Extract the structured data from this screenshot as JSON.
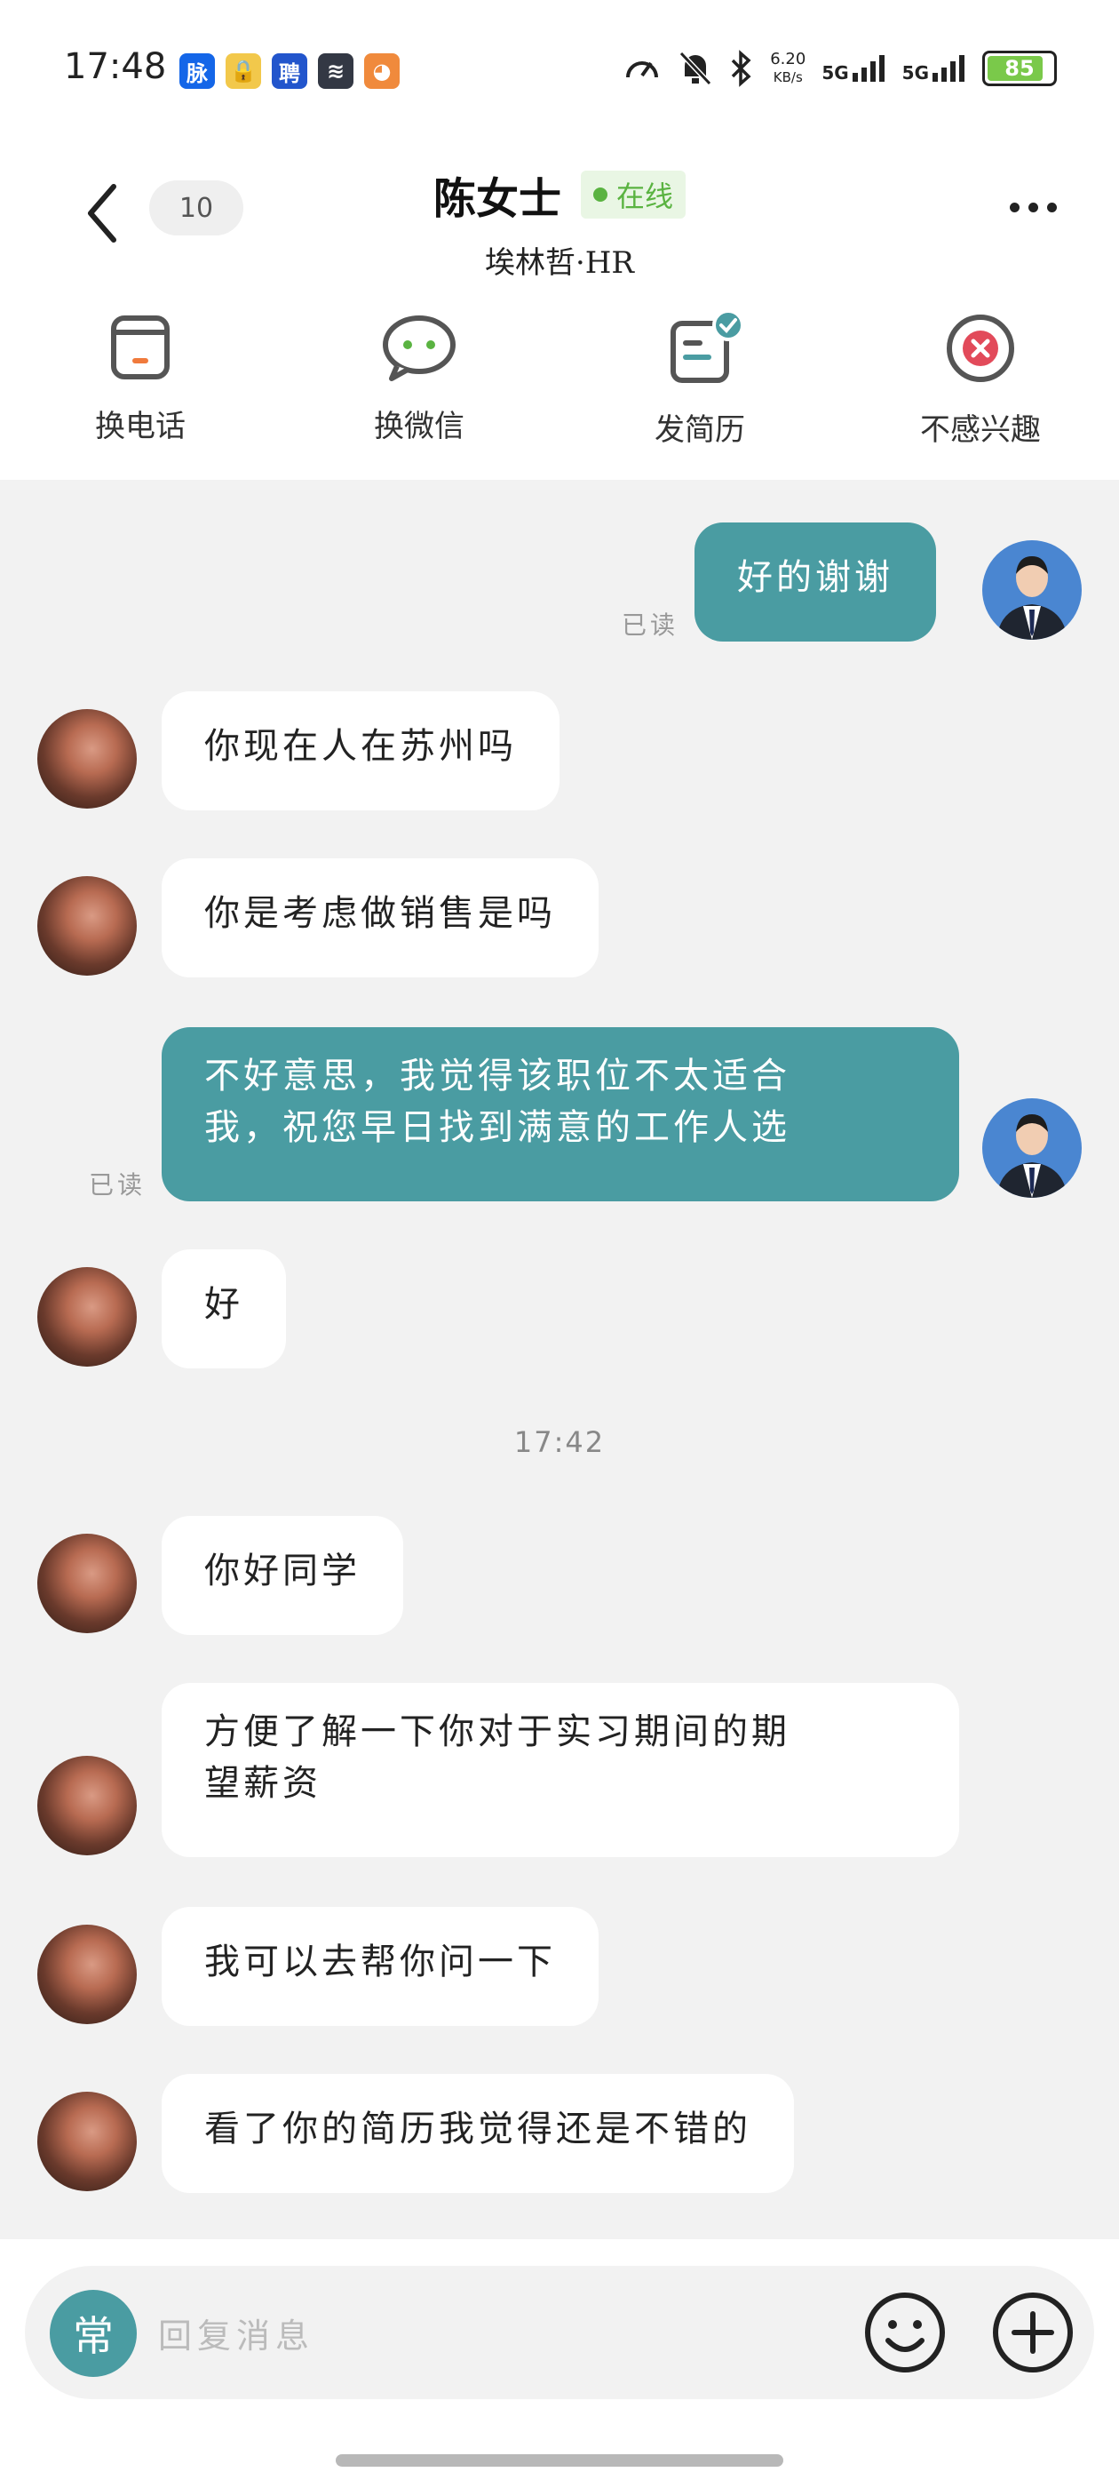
{
  "status_bar": {
    "time": "17:48",
    "app_icons": [
      {
        "label": "脉",
        "color": "#1466e8"
      },
      {
        "label": "🔒",
        "color": "#f2c84b"
      },
      {
        "label": "聘",
        "color": "#2255cc"
      },
      {
        "label": "≋",
        "color": "#333844"
      },
      {
        "label": "◕",
        "color": "#f08a3c"
      }
    ],
    "net_speed": "6.20",
    "net_unit": "KB/s",
    "sim1": "5G",
    "sim2": "5G",
    "battery": "85"
  },
  "header": {
    "unread_count": "10",
    "contact_name": "陈女士",
    "online_status": "在线",
    "subtitle": "埃林哲·HR"
  },
  "actions": [
    {
      "label": "换电话"
    },
    {
      "label": "换微信"
    },
    {
      "label": "发简历"
    },
    {
      "label": "不感兴趣"
    }
  ],
  "messages": {
    "m1": {
      "text": "好的谢谢",
      "read": "已读"
    },
    "m2": {
      "text": "你现在人在苏州吗"
    },
    "m3": {
      "text": "你是考虑做销售是吗"
    },
    "m4": {
      "line1": "不好意思，我觉得该职位不太适合",
      "line2": "我，祝您早日找到满意的工作人选",
      "read": "已读"
    },
    "m5": {
      "text": "好"
    },
    "timestamp": "17:42",
    "m6": {
      "text": "你好同学"
    },
    "m7": {
      "line1": "方便了解一下你对于实习期间的期",
      "line2": "望薪资"
    },
    "m8": {
      "text": "我可以去帮你问一下"
    },
    "m9": {
      "text": "看了你的简历我觉得还是不错的"
    }
  },
  "input": {
    "common_label": "常",
    "placeholder": "回复消息"
  },
  "colors": {
    "accent": "#4a9ca2",
    "online_green": "#5ab341",
    "decline_red": "#e24a5a"
  }
}
